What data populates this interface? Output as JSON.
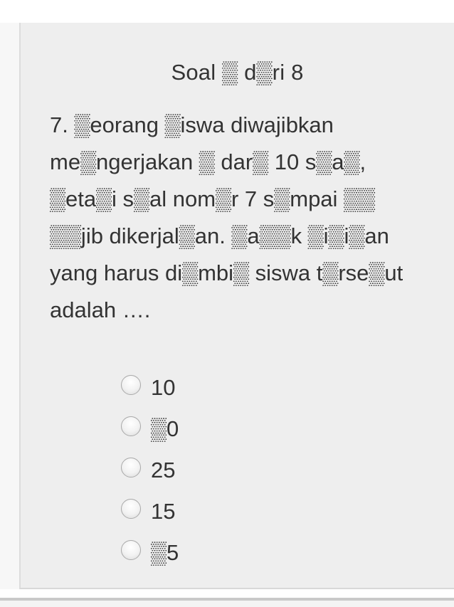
{
  "header": {
    "title": "Soal ▒ d▒ri 8"
  },
  "question": {
    "text": "7. ▒eorang ▒iswa diwajibkan me▒ngerjakan ▒ dar▒ 10 s▒a▒, ▒eta▒i s▒al nom▒r 7 s▒mpai ▒▒ ▒▒jib dikerjal▒an. ▒a▒▒k ▒i▒i▒an yang harus di▒mbi▒ siswa t▒rse▒ut adalah …."
  },
  "options": [
    {
      "label": "10"
    },
    {
      "label": "▒0"
    },
    {
      "label": "25"
    },
    {
      "label": "15"
    },
    {
      "label": "▒5"
    }
  ],
  "colors": {
    "card_background": "#eeeeee",
    "text": "#333333"
  }
}
